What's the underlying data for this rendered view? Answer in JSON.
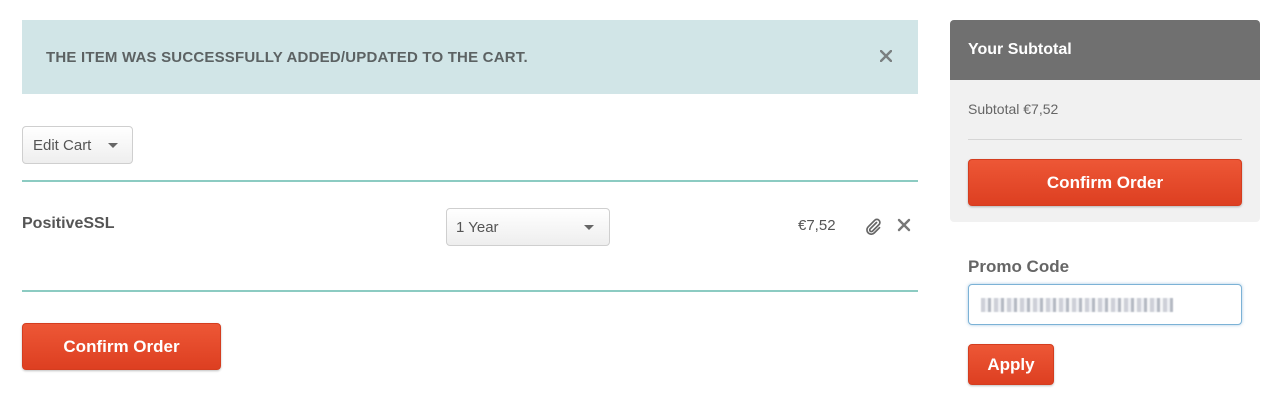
{
  "alert": {
    "message": "THE ITEM WAS SUCCESSFULLY ADDED/UPDATED TO THE CART."
  },
  "cart": {
    "edit_label": "Edit Cart",
    "items": [
      {
        "name": "PositiveSSL",
        "period": "1 Year",
        "price": "€7,52"
      }
    ],
    "confirm_label": "Confirm Order"
  },
  "summary": {
    "title": "Your Subtotal",
    "subtotal_text": "Subtotal €7,52",
    "confirm_label": "Confirm Order"
  },
  "promo": {
    "label": "Promo Code",
    "apply_label": "Apply"
  },
  "colors": {
    "accent": "#e84a2c",
    "alert_bg": "#d1e5e7",
    "divider": "#8ccbc2",
    "summary_header": "#707070"
  },
  "icons": [
    "close-icon",
    "chevron-down-icon",
    "paperclip-icon",
    "remove-icon"
  ]
}
